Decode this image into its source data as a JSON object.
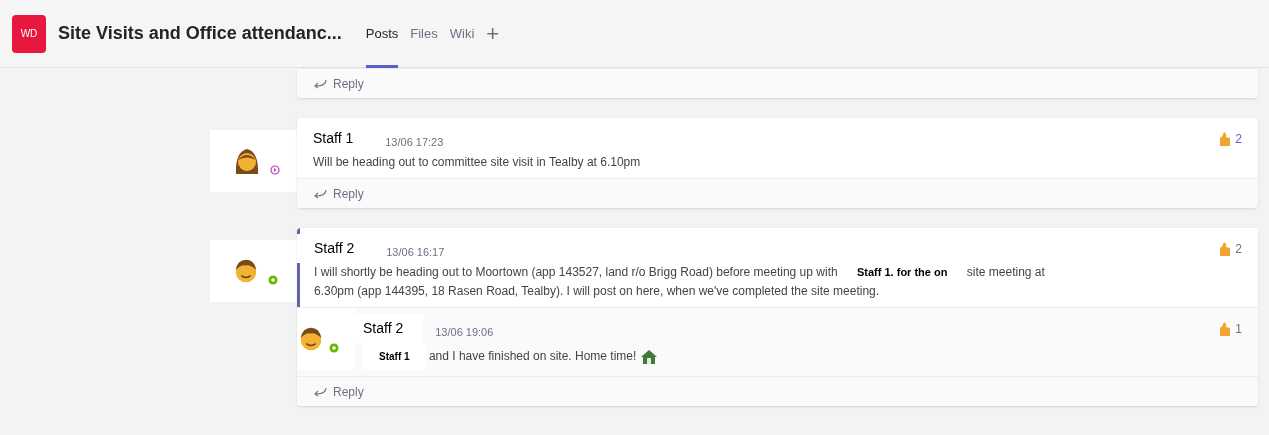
{
  "header": {
    "team_initials": "WD",
    "channel_title": "Site Visits and Office attendanc...",
    "tabs": [
      {
        "label": "Posts",
        "selected": true
      },
      {
        "label": "Files",
        "selected": false
      },
      {
        "label": "Wiki",
        "selected": false
      }
    ],
    "add_tab": "+"
  },
  "threads": [
    {
      "reply_label": "Reply"
    },
    {
      "messages": [
        {
          "author": "Staff 1",
          "time": "13/06 17:23",
          "presence": {
            "kind": "away"
          },
          "avatar": {
            "kind": "woman"
          },
          "highlighted": false,
          "body": [
            {
              "kind": "text",
              "text": "Will be heading out to committee site visit in Tealby at 6.10pm"
            }
          ],
          "reaction": {
            "count": "2",
            "reacted": true
          }
        }
      ],
      "reply_label": "Reply"
    },
    {
      "messages": [
        {
          "author": "Staff 2",
          "time": "13/06 16:17",
          "presence": {
            "kind": "available"
          },
          "avatar": {
            "kind": "man"
          },
          "highlighted": true,
          "body": [
            {
              "kind": "text",
              "text": "I will shortly be heading out to Moortown (app 143527, land r/o Brigg Road) before meeting up with"
            },
            {
              "kind": "mention",
              "text": "Staff 1. for the on"
            },
            {
              "kind": "text",
              "text": "site meeting at"
            },
            {
              "kind": "line",
              "text": "6.30pm (app 144395, 18 Rasen Road, Tealby). I will post on here, when we've completed the site meeting."
            }
          ],
          "reaction": {
            "count": "2",
            "reacted": false
          }
        },
        {
          "author": "Staff 2",
          "time": "13/06 19:06",
          "presence": {
            "kind": "available"
          },
          "avatar": {
            "kind": "man"
          },
          "highlighted": false,
          "body": [
            {
              "kind": "mention",
              "text": "Staff 1"
            },
            {
              "kind": "text",
              "text": "and I have finished on site. Home time!"
            },
            {
              "kind": "emoji"
            }
          ],
          "reaction": {
            "count": "1",
            "reacted": false
          }
        }
      ],
      "reply_label": "Reply"
    }
  ]
}
